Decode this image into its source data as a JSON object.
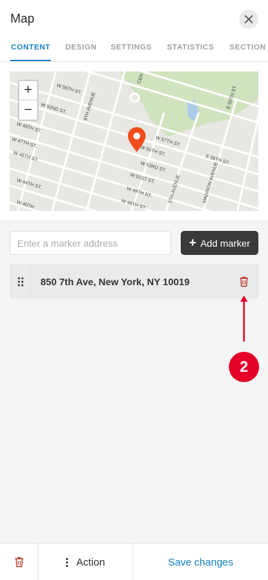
{
  "header": {
    "title": "Map",
    "close_icon": "close-icon"
  },
  "tabs": [
    {
      "label": "CONTENT",
      "active": true
    },
    {
      "label": "DESIGN",
      "active": false
    },
    {
      "label": "SETTINGS",
      "active": false
    },
    {
      "label": "STATISTICS",
      "active": false
    },
    {
      "label": "SECTION",
      "active": false
    }
  ],
  "map": {
    "zoom_in": "+",
    "zoom_out": "−",
    "street_labels": [
      "W 56TH ST.",
      "W 52ND ST.",
      "W 48TH ST.",
      "W 47TH ST.",
      "W 46TH ST.",
      "W 44TH ST.",
      "W 40TH",
      "9TH AVENUE",
      "W 57TH ST.",
      "W 55TH ST.",
      "W 53RD ST.",
      "W 51ST ST.",
      "W 49TH ST.",
      "W 48TH ST.",
      "5TH AVENUE",
      "E 56TH ST.",
      "E 60TH ST.",
      "MADISON AVENUE",
      "CEN"
    ],
    "pin_color": "#f34b1c"
  },
  "marker_form": {
    "address_placeholder": "Enter a marker address",
    "address_value": "",
    "add_button_label": "Add marker"
  },
  "markers": [
    {
      "address": "850 7th Ave, New York, NY 10019"
    }
  ],
  "annotation": {
    "step_number": "2",
    "color": "#e5002a"
  },
  "footer": {
    "action_label": "Action",
    "save_label": "Save changes"
  },
  "colors": {
    "accent": "#1781c4",
    "delete": "#c0392b",
    "dark_button": "#3a3a3a"
  }
}
